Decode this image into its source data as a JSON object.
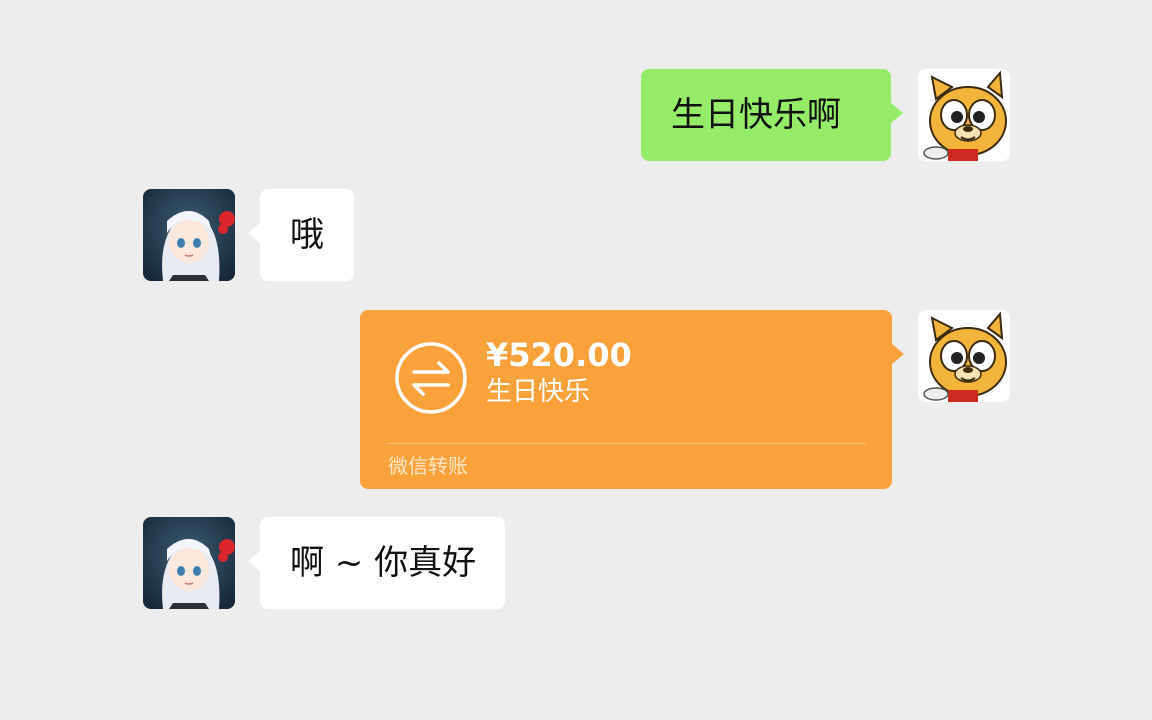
{
  "messages": [
    {
      "side": "right",
      "type": "text",
      "text": "生日快乐啊",
      "avatar": "doge-avatar"
    },
    {
      "side": "left",
      "type": "text",
      "text": "哦",
      "avatar": "anime-girl-avatar"
    },
    {
      "side": "right",
      "type": "transfer",
      "amount": "¥520.00",
      "note": "生日快乐",
      "footer": "微信转账",
      "avatar": "doge-avatar"
    },
    {
      "side": "left",
      "type": "text",
      "text": "啊 ~ 你真好",
      "avatar": "anime-girl-avatar"
    }
  ],
  "colors": {
    "background": "#ededed",
    "sent_bubble": "#95ec69",
    "received_bubble": "#ffffff",
    "transfer_bubble": "#f9a23c"
  },
  "icons": {
    "transfer": "transfer-arrows-icon"
  }
}
